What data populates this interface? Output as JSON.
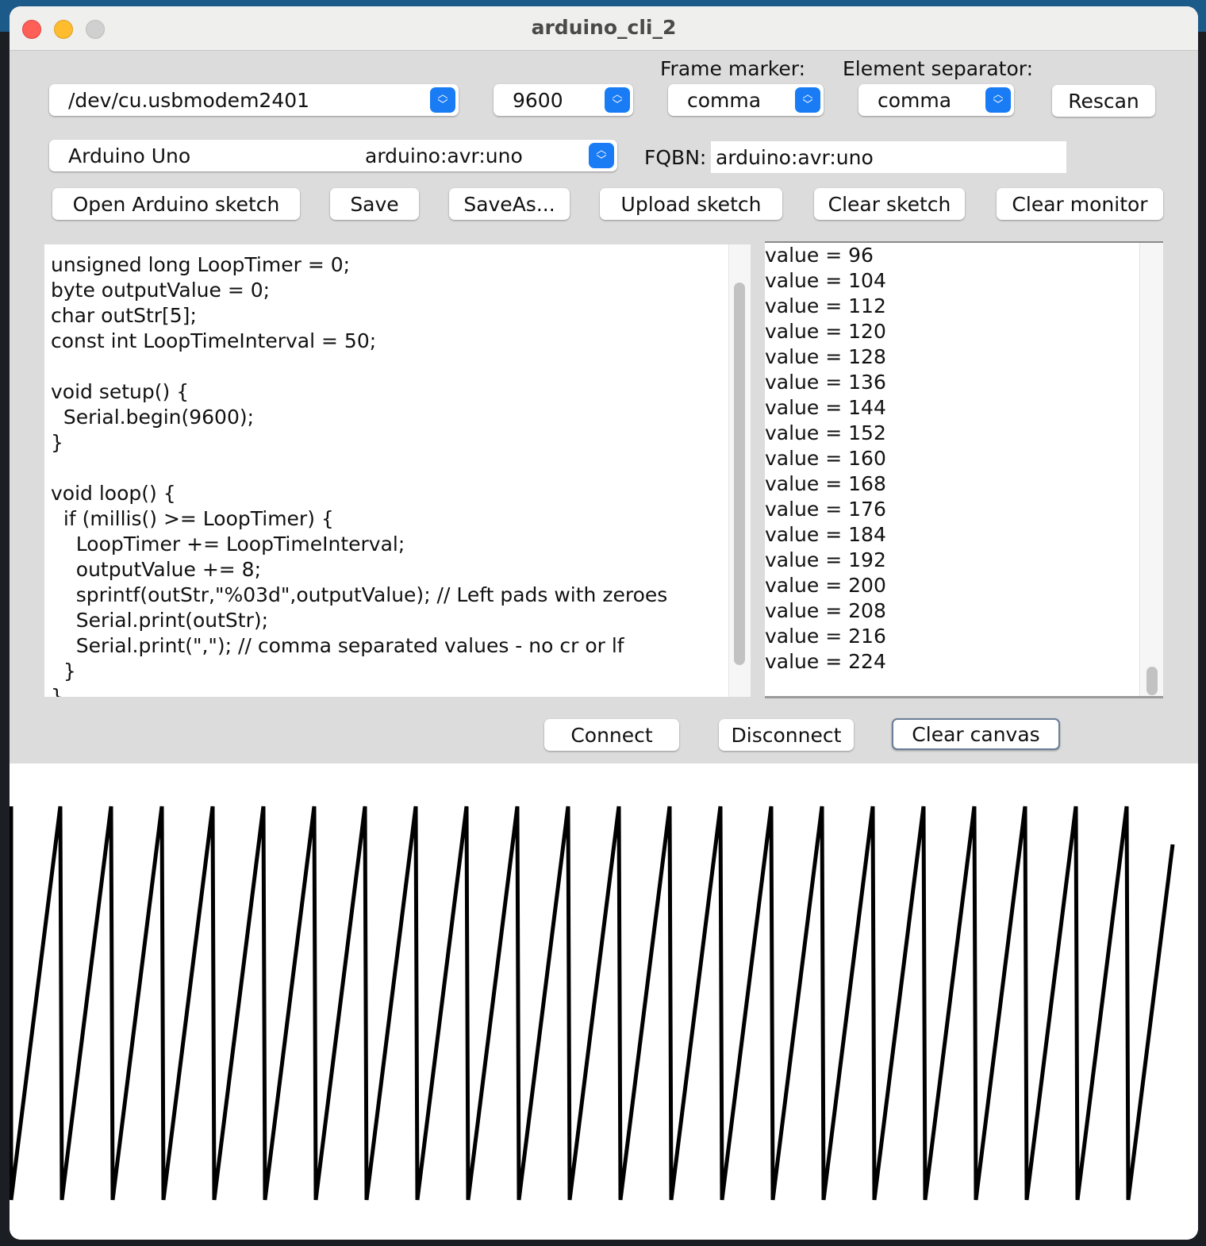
{
  "window": {
    "title": "arduino_cli_2"
  },
  "controls": {
    "port": "/dev/cu.usbmodem2401",
    "baud": "9600",
    "frame_marker_label": "Frame marker:",
    "frame_marker": "comma",
    "element_separator_label": "Element separator:",
    "element_separator": "comma",
    "rescan": "Rescan",
    "board_name": "Arduino Uno",
    "board_fqbn": "arduino:avr:uno",
    "fqbn_label": "FQBN:",
    "fqbn_value": "arduino:avr:uno"
  },
  "buttons": {
    "open": "Open Arduino sketch",
    "save": "Save",
    "save_as": "SaveAs...",
    "upload": "Upload sketch",
    "clear_sketch": "Clear sketch",
    "clear_monitor": "Clear monitor",
    "connect": "Connect",
    "disconnect": "Disconnect",
    "clear_canvas": "Clear canvas"
  },
  "sketch": "unsigned long LoopTimer = 0;\nbyte outputValue = 0;\nchar outStr[5];\nconst int LoopTimeInterval = 50;\n\nvoid setup() {\n  Serial.begin(9600);\n}\n\nvoid loop() {\n  if (millis() >= LoopTimer) {\n    LoopTimer += LoopTimeInterval;\n    outputValue += 8;\n    sprintf(outStr,\"%03d\",outputValue); // Left pads with zeroes\n    Serial.print(outStr);\n    Serial.print(\",\"); // comma separated values - no cr or lf\n  }\n}",
  "monitor": [
    "value = 96",
    "value = 104",
    "value = 112",
    "value = 120",
    "value = 128",
    "value = 136",
    "value = 144",
    "value = 152",
    "value = 160",
    "value = 168",
    "value = 176",
    "value = 184",
    "value = 192",
    "value = 200",
    "value = 208",
    "value = 216",
    "value = 224"
  ],
  "chart_data": {
    "type": "line",
    "title": "",
    "description_values": "sawtooth of serial values, increment 8 wrapping at 256",
    "period_values": [
      0,
      8,
      16,
      24,
      32,
      40,
      48,
      56,
      64,
      72,
      80,
      88,
      96,
      104,
      112,
      120,
      128,
      136,
      144,
      152,
      160,
      168,
      176,
      184,
      192,
      200,
      208,
      216,
      224,
      232,
      240,
      248
    ],
    "full_periods": 22,
    "final_partial_values": [
      0,
      8,
      16,
      24,
      32,
      40,
      48,
      56,
      64,
      72,
      80,
      88,
      96,
      104,
      112,
      120,
      128,
      136,
      144,
      152,
      160,
      168,
      176,
      184,
      192,
      200,
      208,
      216,
      224
    ],
    "ylim": [
      0,
      248
    ],
    "color": "#000000"
  }
}
